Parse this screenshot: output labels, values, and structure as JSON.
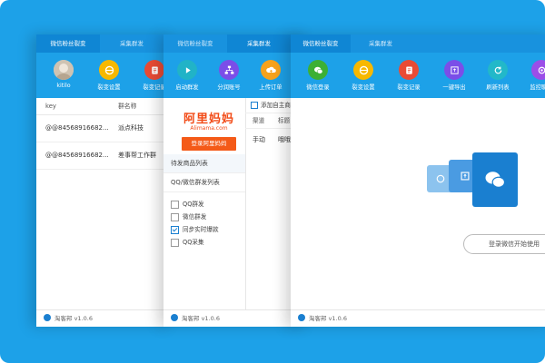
{
  "colors": {
    "brand_blue": "#1da1e8",
    "dark_tab": "#0f86d4",
    "orange": "#f45a18",
    "wechat_blue": "#1a7fd0"
  },
  "win1": {
    "tabs": [
      "微信粉丝裂变",
      "采集群发"
    ],
    "toolbar": [
      {
        "icon": "avatar-photo",
        "label": "kitilo"
      },
      {
        "icon": "fission-icon",
        "label": "裂变设置"
      },
      {
        "icon": "record-icon",
        "label": "裂变记录"
      }
    ],
    "columns": [
      "key",
      "群名称"
    ],
    "rows": [
      {
        "key": "@@84568916682...",
        "name": "派点科技"
      },
      {
        "key": "@@84568916682...",
        "name": "差事帮工作群"
      }
    ],
    "footer": "淘客邦 v1.0.6"
  },
  "win2": {
    "tabs": [
      "微信粉丝裂变",
      "采集群发"
    ],
    "toolbar": [
      {
        "icon": "play-icon",
        "label": "启动群发"
      },
      {
        "icon": "sitemap-icon",
        "label": "分润账号"
      },
      {
        "icon": "upload-cloud-icon",
        "label": "上传订单"
      }
    ],
    "alimama": {
      "logo": "阿里妈妈",
      "sub": "Alimama.com",
      "button": "登录阿里妈妈"
    },
    "sidebar": [
      "待发商品列表",
      "QQ/微信群发列表"
    ],
    "checks": [
      {
        "label": "QQ群发",
        "checked": false
      },
      {
        "label": "微信群发",
        "checked": false
      },
      {
        "label": "同步实时爆款",
        "checked": true
      },
      {
        "label": "QQ采集",
        "checked": false
      }
    ],
    "strip": {
      "add": "添加自主商",
      "cols": [
        "渠道",
        "标题"
      ],
      "row": [
        "手动",
        "哦哦"
      ]
    },
    "footer": "淘客邦 v1.0.6"
  },
  "win3": {
    "tabs": [
      "微信粉丝裂变",
      "采集群发"
    ],
    "toolbar": [
      {
        "icon": "wechat-icon",
        "label": "微信登录"
      },
      {
        "icon": "fission-icon",
        "label": "裂变设置"
      },
      {
        "icon": "record-icon",
        "label": "裂变记录"
      },
      {
        "icon": "export-icon",
        "label": "一键导出"
      },
      {
        "icon": "refresh-icon",
        "label": "刷新列表"
      },
      {
        "icon": "monitor-icon",
        "label": "监控聊天"
      }
    ],
    "login_button": "登录微信开始使用",
    "footer": "淘客邦 v1.0.6"
  }
}
